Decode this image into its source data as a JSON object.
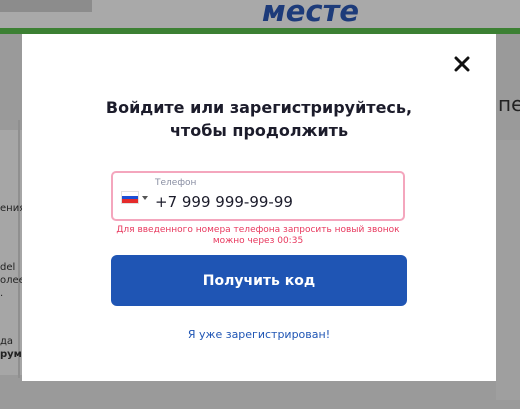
{
  "background": {
    "heading": "месте",
    "right_text": "пер",
    "left_fragments": [
      "ения",
      "del",
      "олее",
      ".",
      "да",
      "рум"
    ]
  },
  "modal": {
    "title_line1": "Войдите или зарегистрируйтесь,",
    "title_line2": "чтобы продолжить",
    "phone": {
      "label": "Телефон",
      "value": "+7 999 999-99-99",
      "country_flag": "ru-flag-icon"
    },
    "error": "Для введенного номера телефона запросить новый звонок можно через 00:35",
    "submit_label": "Получить код",
    "registered_link": "Я уже зарегистрирован!"
  },
  "colors": {
    "accent": "#1f55b4",
    "error": "#e8385e",
    "input_border": "#f4a6bd",
    "overlay": "#9a9a9a"
  }
}
